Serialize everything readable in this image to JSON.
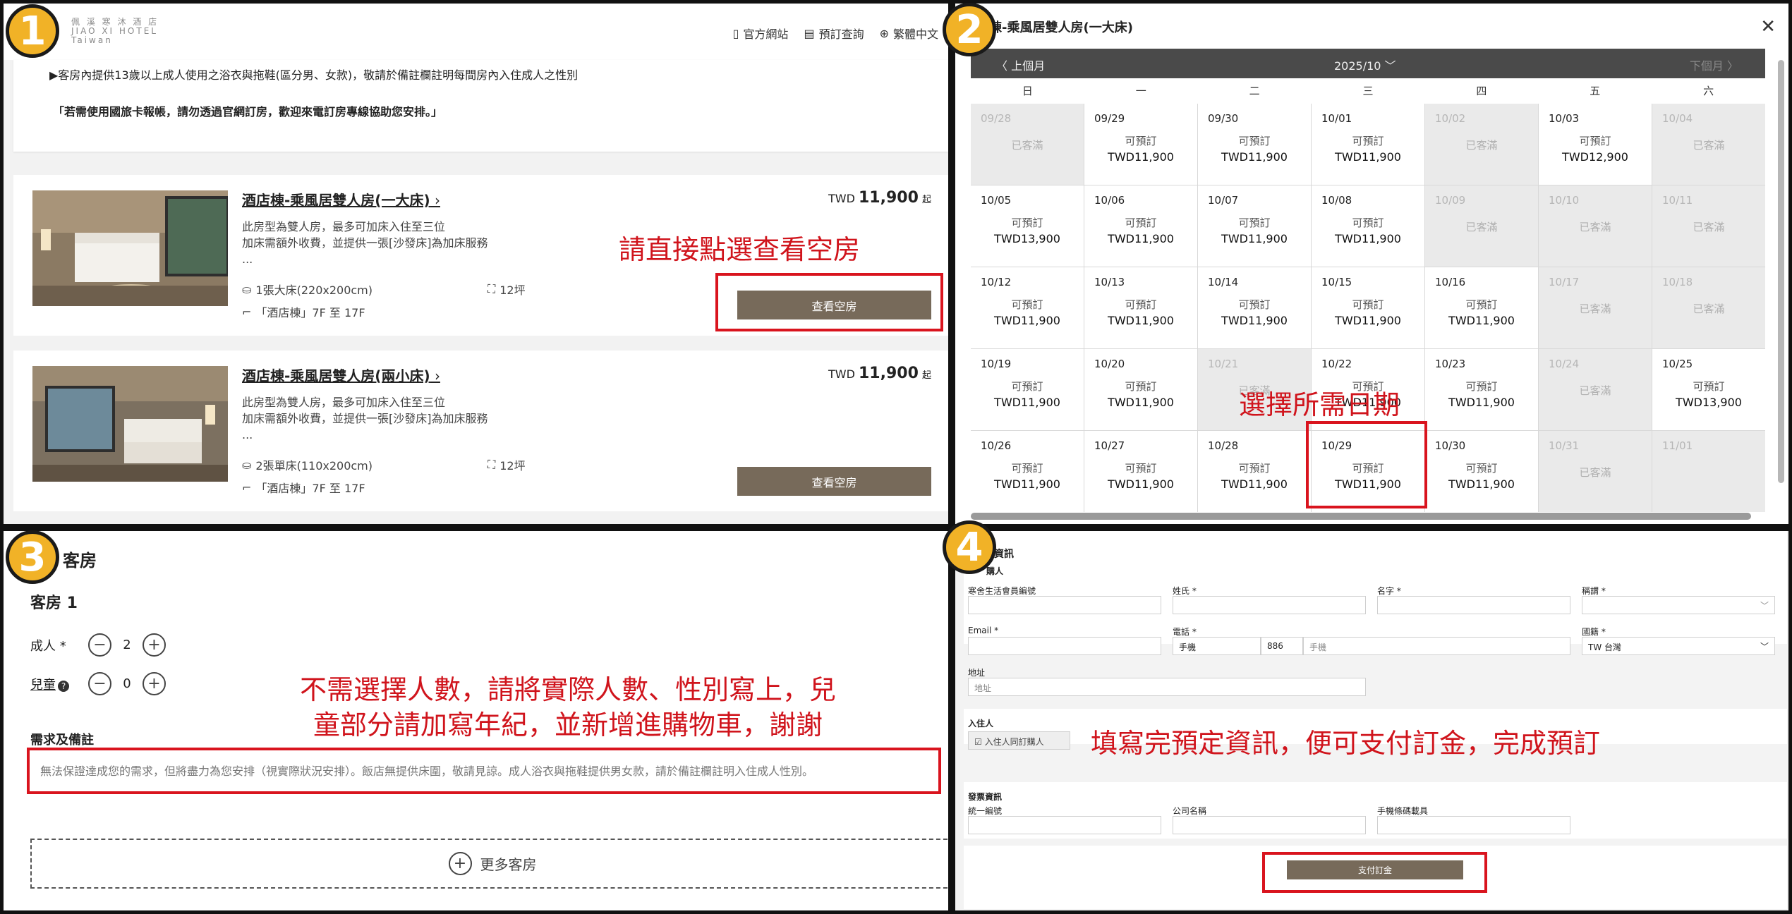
{
  "panel1": {
    "badge": "1",
    "logo_lines": [
      "佩 溪 寒 沐 酒 店",
      "JIAO XI HOTEL",
      "Taiwan"
    ],
    "nav": {
      "official": "官方網站",
      "lookup": "預訂查詢",
      "language": "繁體中文"
    },
    "notice_line1": "▶客房內提供13歲以上成人使用之浴衣與拖鞋(區分男、女款)，敬請於備註欄註明每間房內入住成人之性別",
    "notice_line2": "「若需使用國旅卡報帳，請勿透過官網訂房，歡迎來電訂房專線協助您安排。」",
    "rooms": [
      {
        "title": "酒店棟-乘風居雙人房(一大床)",
        "desc1": "此房型為雙人房，最多可加床入住至三位",
        "desc2": "加床需額外收費，並提供一張[沙發床]為加床服務",
        "desc3": "...",
        "bed": "1張大床(220x200cm)",
        "size": "12坪",
        "floor": "「酒店棟」7F 至 17F",
        "price_cur": "TWD",
        "price": "11,900",
        "price_suffix": "起",
        "button": "查看空房"
      },
      {
        "title": "酒店棟-乘風居雙人房(兩小床)",
        "desc1": "此房型為雙人房，最多可加床入住至三位",
        "desc2": "加床需額外收費，並提供一張[沙發床]為加床服務",
        "desc3": "...",
        "bed": "2張單床(110x200cm)",
        "size": "12坪",
        "floor": "「酒店棟」7F 至 17F",
        "price_cur": "TWD",
        "price": "11,900",
        "price_suffix": "起",
        "button": "查看空房"
      }
    ],
    "annotation": "請直接點選查看空房"
  },
  "panel2": {
    "badge": "2",
    "title": "店棟-乘風居雙人房(一大床)",
    "prev": "〈 上個月",
    "month": "2025/10 ﹀",
    "next": "下個月 〉",
    "weekdays": [
      "日",
      "一",
      "二",
      "三",
      "四",
      "五",
      "六"
    ],
    "available": "可預訂",
    "full": "已客滿",
    "days": [
      {
        "d": "09/28",
        "s": "full"
      },
      {
        "d": "09/29",
        "p": "TWD11,900"
      },
      {
        "d": "09/30",
        "p": "TWD11,900"
      },
      {
        "d": "10/01",
        "p": "TWD11,900"
      },
      {
        "d": "10/02",
        "s": "full"
      },
      {
        "d": "10/03",
        "p": "TWD12,900"
      },
      {
        "d": "10/04",
        "s": "full"
      },
      {
        "d": "10/05",
        "p": "TWD13,900"
      },
      {
        "d": "10/06",
        "p": "TWD11,900"
      },
      {
        "d": "10/07",
        "p": "TWD11,900"
      },
      {
        "d": "10/08",
        "p": "TWD11,900"
      },
      {
        "d": "10/09",
        "s": "full"
      },
      {
        "d": "10/10",
        "s": "full"
      },
      {
        "d": "10/11",
        "s": "full"
      },
      {
        "d": "10/12",
        "p": "TWD11,900"
      },
      {
        "d": "10/13",
        "p": "TWD11,900"
      },
      {
        "d": "10/14",
        "p": "TWD11,900"
      },
      {
        "d": "10/15",
        "p": "TWD11,900"
      },
      {
        "d": "10/16",
        "p": "TWD11,900"
      },
      {
        "d": "10/17",
        "s": "full"
      },
      {
        "d": "10/18",
        "s": "full"
      },
      {
        "d": "10/19",
        "p": "TWD11,900"
      },
      {
        "d": "10/20",
        "p": "TWD11,900"
      },
      {
        "d": "10/21",
        "s": "full"
      },
      {
        "d": "10/22",
        "p": "TWD11,900"
      },
      {
        "d": "10/23",
        "p": "TWD11,900"
      },
      {
        "d": "10/24",
        "s": "full"
      },
      {
        "d": "10/25",
        "p": "TWD13,900"
      },
      {
        "d": "10/26",
        "p": "TWD11,900"
      },
      {
        "d": "10/27",
        "p": "TWD11,900"
      },
      {
        "d": "10/28",
        "p": "TWD11,900"
      },
      {
        "d": "10/29",
        "p": "TWD11,900"
      },
      {
        "d": "10/30",
        "p": "TWD11,900"
      },
      {
        "d": "10/31",
        "s": "full"
      },
      {
        "d": "11/01",
        "s": "blank"
      }
    ],
    "annotation": "選擇所需日期"
  },
  "panel3": {
    "badge": "3",
    "title": "客房",
    "room": "客房 1",
    "adult_label": "成人 *",
    "adult_value": "2",
    "child_label": "兒童",
    "child_value": "0",
    "req_label": "需求及備註",
    "req_placeholder": "無法保證達成您的需求，但將盡力為您安排（視實際狀況安排）。飯店無提供床圍，敬請見諒。成人浴衣與拖鞋提供男女款，請於備註欄註明入住成人性別。",
    "more_rooms": "更多客房",
    "annotation_line1": "不需選擇人數，請將實際人數、性別寫上，兒",
    "annotation_line2": "童部分請加寫年紀，並新增進購物車，謝謝"
  },
  "panel4": {
    "badge": "4",
    "title": "資訊",
    "buyer": "購人",
    "member_label": "寒舍生活會員編號",
    "lastname_label": "姓氏 *",
    "firstname_label": "名字 *",
    "salutation_label": "稱謂 *",
    "email_label": "Email *",
    "phone_label": "電話 *",
    "phone_type": "手機",
    "phone_code": "886",
    "phone_placeholder": "手機",
    "country_label": "國籍 *",
    "country_value": "TW 台灣",
    "address_label": "地址",
    "address_placeholder": "地址",
    "guest_label": "入住人",
    "same_as_buyer": "入住人同訂購人",
    "invoice_label": "發票資訊",
    "tax_id_label": "統一編號",
    "company_label": "公司名稱",
    "carrier_label": "手機條碼載具",
    "pay_button": "支付訂金",
    "annotation": "填寫完預定資訊，便可支付訂金，完成預訂"
  }
}
